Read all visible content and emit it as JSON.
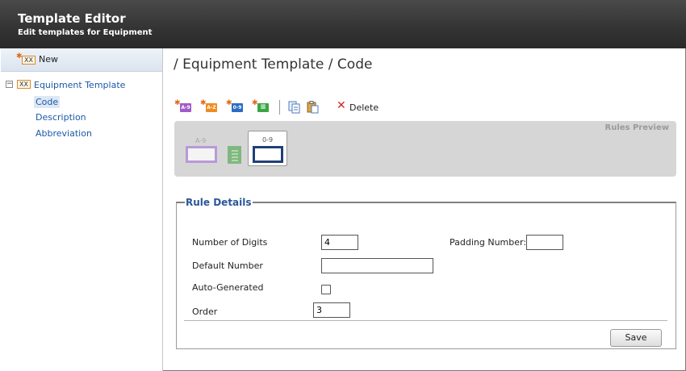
{
  "header": {
    "title": "Template Editor",
    "subtitle": "Edit templates for Equipment"
  },
  "sidebar": {
    "new_label": "New",
    "new_icon": "xx-new-icon",
    "icon_text": "XX",
    "tree": {
      "toggle": "−",
      "root_label": "Equipment Template",
      "children": [
        {
          "label": "Code",
          "selected": true
        },
        {
          "label": "Description",
          "selected": false
        },
        {
          "label": "Abbreviation",
          "selected": false
        }
      ]
    }
  },
  "breadcrumb": "/ Equipment Template / Code",
  "toolbar": {
    "buttons": [
      {
        "icon": "add-alphanumeric-rule-icon",
        "text": "A-9",
        "color": "#a05bc7"
      },
      {
        "icon": "add-alpha-rule-icon",
        "text": "A-Z",
        "color": "#f08b1f"
      },
      {
        "icon": "add-numeric-rule-icon",
        "text": "0-9",
        "color": "#2b6cc4"
      },
      {
        "icon": "add-list-rule-icon",
        "text": "≡",
        "color": "#3aa643"
      }
    ],
    "copy_icon": "copy-icon",
    "paste_icon": "paste-icon",
    "delete_label": "Delete"
  },
  "preview": {
    "title": "Rules Preview",
    "items": [
      {
        "label": "A-9",
        "type": "alphanumeric",
        "color": "#b89ad9"
      },
      {
        "label": "",
        "type": "list",
        "color": "#7fb87f"
      },
      {
        "label": "0-9",
        "type": "numeric",
        "color": "#1f3f7a",
        "selected": true
      }
    ]
  },
  "details": {
    "legend": "Rule Details",
    "digits_label": "Number of Digits",
    "digits_value": "4",
    "padding_label": "Padding Number:",
    "padding_value": "",
    "default_label": "Default Number",
    "default_value": "",
    "auto_label": "Auto-Generated",
    "auto_checked": false,
    "order_label": "Order",
    "order_value": "3",
    "save_label": "Save"
  },
  "colors": {
    "header_bg": "#333333",
    "link": "#1a5aa8",
    "legend": "#2b5797",
    "delete": "#d42323"
  }
}
